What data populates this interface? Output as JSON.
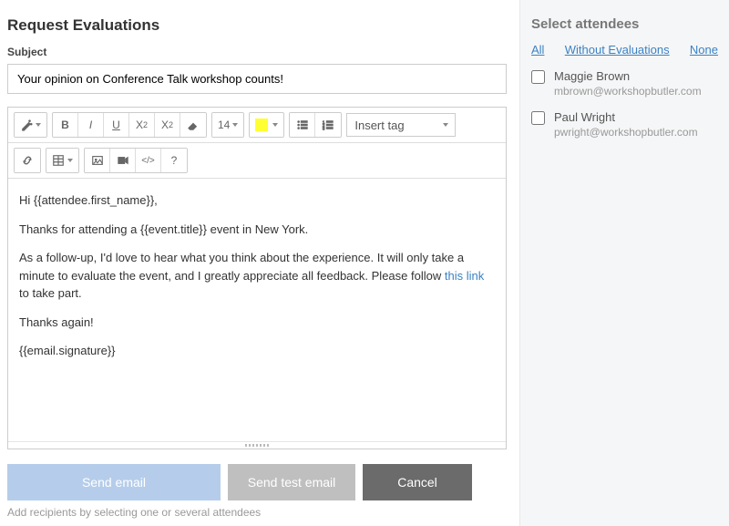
{
  "left": {
    "title": "Request Evaluations",
    "subject_label": "Subject",
    "subject_value": "Your opinion on Conference Talk workshop counts!",
    "font_size": "14",
    "insert_tag_placeholder": "Insert tag",
    "body": {
      "p1": "Hi {{attendee.first_name}},",
      "p2": "Thanks for attending a {{event.title}} event in New York.",
      "p3a": "As a follow-up, I'd love to hear what you think about the experience. It will only take a minute to evaluate the event, and I greatly appreciate all feedback. Please follow ",
      "p3_link": "this link",
      "p3b": " to take part.",
      "p4": "Thanks again!",
      "p5": "{{email.signature}}"
    },
    "actions": {
      "send": "Send email",
      "send_test": "Send test email",
      "cancel": "Cancel"
    },
    "hint": "Add recipients by selecting one or several attendees"
  },
  "right": {
    "title": "Select attendees",
    "filters": {
      "all": "All",
      "without": "Without Evaluations",
      "none": "None"
    },
    "attendees": [
      {
        "name": "Maggie Brown",
        "email": "mbrown@workshopbutler.com"
      },
      {
        "name": "Paul Wright",
        "email": "pwright@workshopbutler.com"
      }
    ]
  }
}
